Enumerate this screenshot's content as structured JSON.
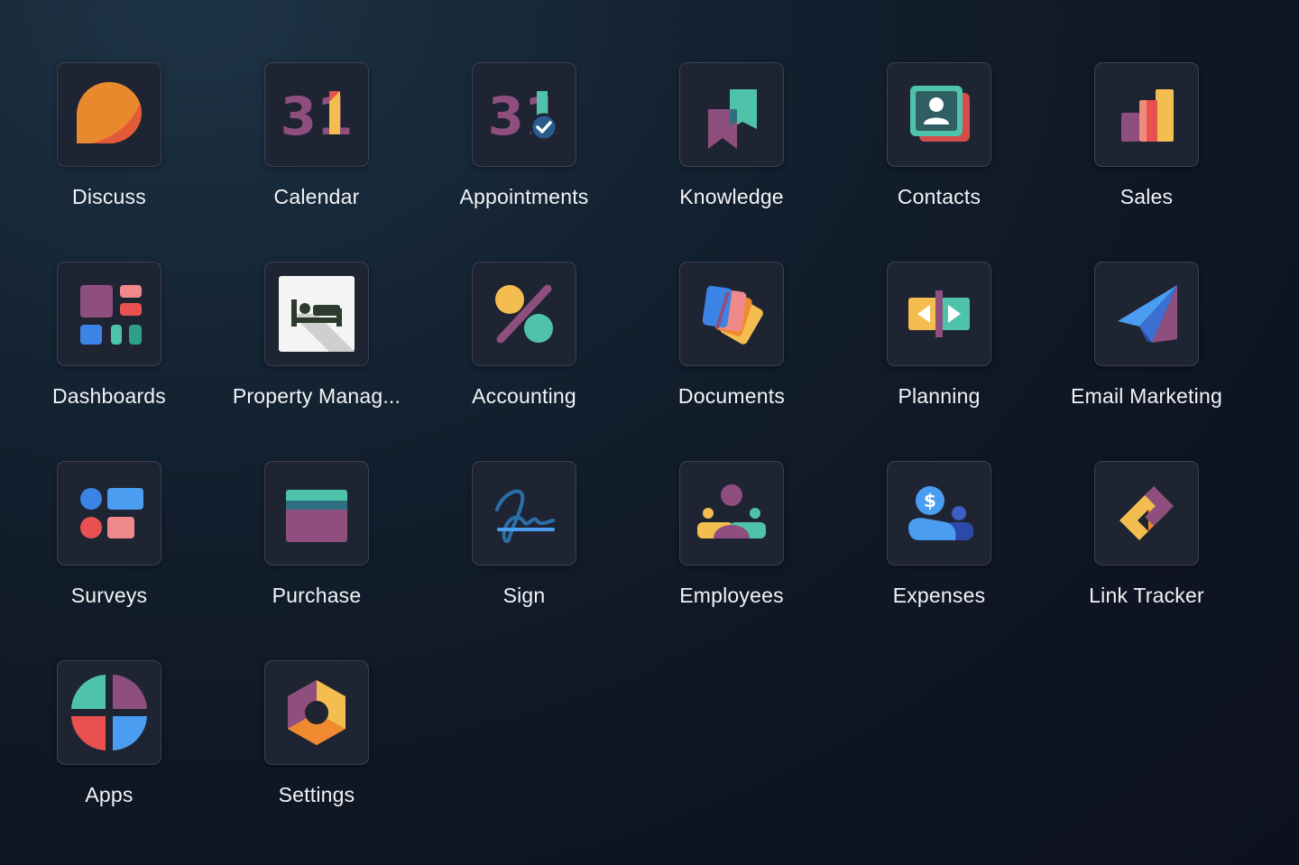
{
  "apps": [
    {
      "label": "Discuss",
      "icon": "discuss-icon"
    },
    {
      "label": "Calendar",
      "icon": "calendar-icon",
      "icon_text": "31"
    },
    {
      "label": "Appointments",
      "icon": "appointments-icon",
      "icon_text": "31"
    },
    {
      "label": "Knowledge",
      "icon": "knowledge-icon"
    },
    {
      "label": "Contacts",
      "icon": "contacts-icon"
    },
    {
      "label": "Sales",
      "icon": "sales-icon"
    },
    {
      "label": "Dashboards",
      "icon": "dashboards-icon"
    },
    {
      "label": "Property Manag...",
      "icon": "property-management-icon"
    },
    {
      "label": "Accounting",
      "icon": "accounting-icon"
    },
    {
      "label": "Documents",
      "icon": "documents-icon"
    },
    {
      "label": "Planning",
      "icon": "planning-icon"
    },
    {
      "label": "Email Marketing",
      "icon": "email-marketing-icon"
    },
    {
      "label": "Surveys",
      "icon": "surveys-icon"
    },
    {
      "label": "Purchase",
      "icon": "purchase-icon"
    },
    {
      "label": "Sign",
      "icon": "sign-icon"
    },
    {
      "label": "Employees",
      "icon": "employees-icon"
    },
    {
      "label": "Expenses",
      "icon": "expenses-icon",
      "icon_text": "$"
    },
    {
      "label": "Link Tracker",
      "icon": "link-tracker-icon"
    },
    {
      "label": "Apps",
      "icon": "apps-icon"
    },
    {
      "label": "Settings",
      "icon": "settings-icon"
    }
  ],
  "colors": {
    "background": "#0f1624",
    "tile": "#1f2433",
    "tile_border": "#3a4152",
    "label": "#f2f3f6",
    "purple": "#8e4f7e",
    "teal": "#4fc3aa",
    "orange": "#f08a30",
    "yellow": "#f3bd4f",
    "red": "#e8514f",
    "blue": "#4a9df0"
  }
}
